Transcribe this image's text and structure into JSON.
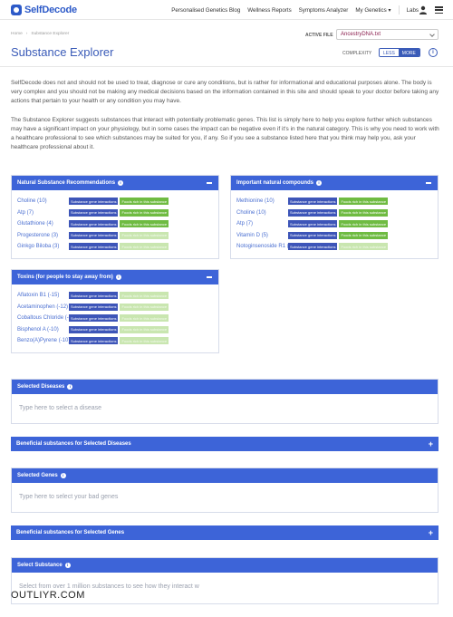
{
  "nav": {
    "logo": "SelfDecode",
    "links": [
      "Personalised Genetics Blog",
      "Wellness Reports",
      "Symptoms Analyzer",
      "My Genetics",
      "Labs"
    ]
  },
  "breadcrumb": [
    "Home",
    "Substance Explorer"
  ],
  "page_title": "Substance Explorer",
  "active_file": {
    "label": "ACTIVE FILE",
    "value": "AncestryDNA.txt"
  },
  "complexity": {
    "label": "COMPLEXITY",
    "less": "LESS",
    "more": "MORE",
    "selected": "MORE"
  },
  "intro": [
    "SelfDecode does not and should not be used to treat, diagnose or cure any conditions, but is rather for informational and educational purposes alone. The body is very complex and you should not be making any medical decisions based on the information contained in this site and should speak to your doctor before taking any actions that pertain to your health or any condition you may have.",
    "The Substance Explorer suggests substances that interact with potentially problematic genes. This list is simply here to help you explore further which substances may have a significant impact on your physiology, but in some cases the impact can be negative even if it's in the natural category. This is why you need to work with a healthcare professional to see which substances may be suited for you, if any. So if you see a substance listed here that you think may help you, ask your healthcare professional about it."
  ],
  "badges": {
    "gene": "Substance gene interactions",
    "foods": "Foods rich in this substance"
  },
  "natural": {
    "title": "Natural Substance Recommendations",
    "items": [
      {
        "name": "Choline (10)",
        "foods_active": true
      },
      {
        "name": "Atp (7)",
        "foods_active": true
      },
      {
        "name": "Glutathione (4)",
        "foods_active": true
      },
      {
        "name": "Progesterone (3)",
        "foods_active": false
      },
      {
        "name": "Ginkgo Biloba (3)",
        "foods_active": false
      }
    ]
  },
  "important": {
    "title": "Important natural compounds",
    "items": [
      {
        "name": "Methionine (10)",
        "foods_active": true
      },
      {
        "name": "Choline (10)",
        "foods_active": true
      },
      {
        "name": "Atp (7)",
        "foods_active": true
      },
      {
        "name": "Vitamin D (5)",
        "foods_active": true
      },
      {
        "name": "Notoginsenoside R1 (5)",
        "foods_active": false
      }
    ]
  },
  "toxins": {
    "title": "Toxins (for people to stay away from)",
    "items": [
      {
        "name": "Aflatoxin B1 (-15)",
        "foods_active": false
      },
      {
        "name": "Acetaminophen (-12)",
        "foods_active": false
      },
      {
        "name": "Cobaltous Chloride (-10)",
        "foods_active": false
      },
      {
        "name": "Bisphenol A (-10)",
        "foods_active": false
      },
      {
        "name": "Benzo(A)Pyrene (-10)",
        "foods_active": false
      }
    ]
  },
  "selected_diseases": {
    "title": "Selected Diseases",
    "placeholder": "Type here to select a disease"
  },
  "beneficial_diseases": {
    "title": "Beneficial substances for Selected Diseases"
  },
  "selected_genes": {
    "title": "Selected Genes",
    "placeholder": "Type here to select your bad genes"
  },
  "beneficial_genes": {
    "title": "Beneficial substances for Selected Genes"
  },
  "select_substance": {
    "title": "Select Substance",
    "placeholder": "Select from over 1 million substances to see how they interact w"
  },
  "watermark": "OUTLIYR.COM",
  "colors": {
    "primary": "#3d64d8",
    "link": "#4a6fd1",
    "green": "#6fbb42",
    "file": "#8a1e4e"
  }
}
